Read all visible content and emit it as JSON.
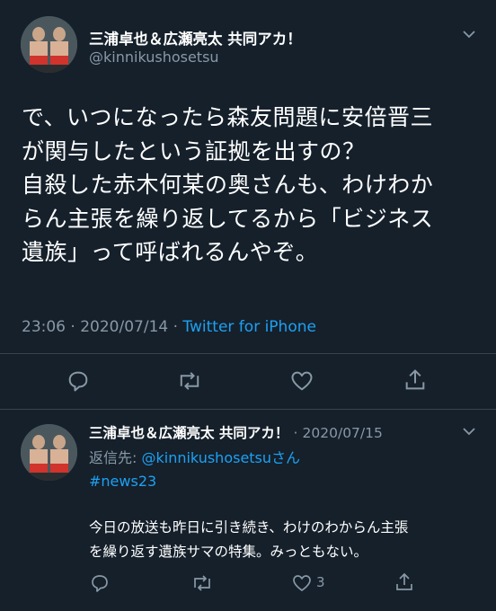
{
  "main_tweet": {
    "display_name": "三浦卓也＆広瀬亮太 共同アカ！",
    "handle": "@kinnikushosetsu",
    "body_lines": [
      "で、いつになったら森友問題に安倍晋三",
      "が関与したという証拠を出すの？",
      "自殺した赤木何某の奥さんも、わけわか",
      "らん主張を繰り返してるから「ビジネス",
      "遺族」って呼ばれるんやぞ。"
    ],
    "time": "23:06",
    "date": "2020/07/14",
    "separator": "·",
    "source": "Twitter for iPhone"
  },
  "reply_tweet": {
    "display_name": "三浦卓也＆広瀬亮太 共同アカ！",
    "separator": "·",
    "date": "2020/07/15",
    "reply_to_label": "返信先: ",
    "reply_to_handle": "@kinnikushosetsu",
    "reply_to_suffix": "さん",
    "hashtag": "#news23",
    "body_lines": [
      "今日の放送も昨日に引き続き、わけのわからん主張",
      "を繰り返す遺族サマの特集。みっともない。"
    ],
    "like_count": "3"
  },
  "icons": {
    "chevron": "chevron-down-icon",
    "reply": "reply-icon",
    "retweet": "retweet-icon",
    "like": "heart-icon",
    "share": "share-icon"
  },
  "colors": {
    "background": "#15202b",
    "text": "#ffffff",
    "muted": "#8899a6",
    "link": "#1da1f2",
    "divider": "#38444d"
  }
}
